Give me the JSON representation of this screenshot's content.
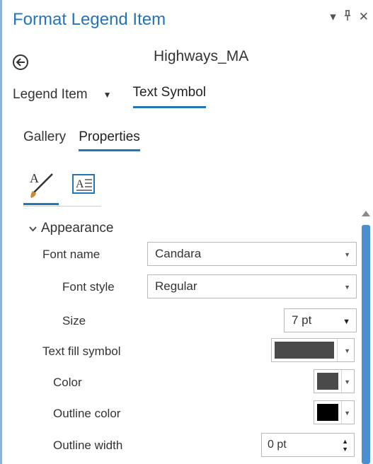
{
  "window": {
    "title": "Format Legend Item",
    "ctrl_menu": "▾",
    "ctrl_pin": "ᵖ",
    "ctrl_close": "✕"
  },
  "header": {
    "layer_name": "Highways_MA"
  },
  "mode_tabs": {
    "legend_item": "Legend Item",
    "text_symbol": "Text Symbol"
  },
  "sub_tabs": {
    "gallery": "Gallery",
    "properties": "Properties"
  },
  "icons": {
    "back": "back-arrow-icon",
    "tab1": "text-brush-icon",
    "tab2": "text-frame-icon"
  },
  "appearance": {
    "section_label": "Appearance",
    "font_name_label": "Font name",
    "font_name_value": "Candara",
    "font_style_label": "Font style",
    "font_style_value": "Regular",
    "size_label": "Size",
    "size_value": "7 pt",
    "text_fill_label": "Text fill symbol",
    "color_label": "Color",
    "outline_color_label": "Outline color",
    "outline_width_label": "Outline width",
    "outline_width_value": "0 pt"
  },
  "colors": {
    "accent": "#2474b8",
    "fill_symbol": "#4a4a4a",
    "color_swatch": "#4a4a4a",
    "outline_swatch": "#000000",
    "scroll_thumb": "#4a8fd0"
  }
}
